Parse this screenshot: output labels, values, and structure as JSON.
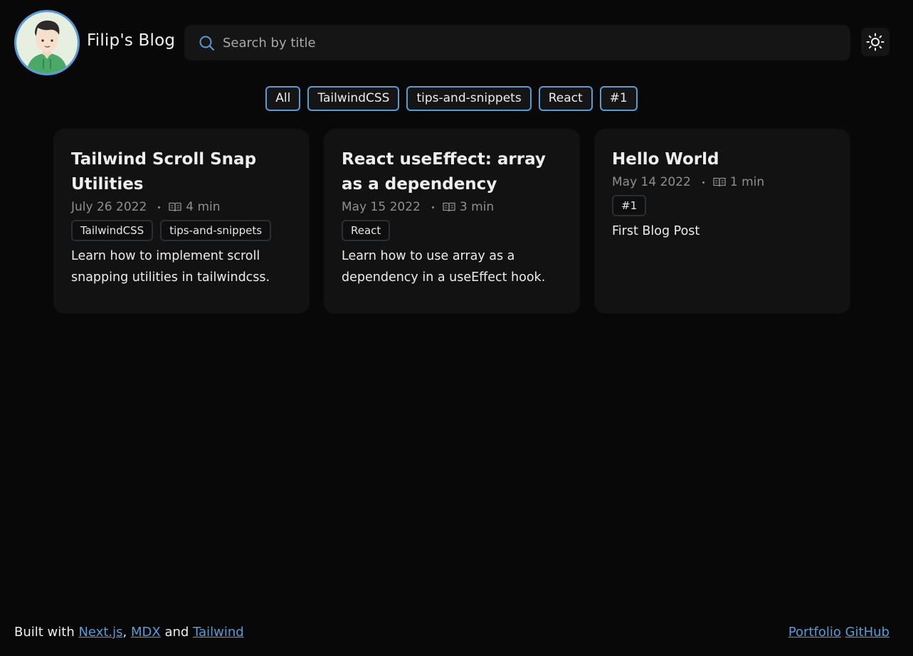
{
  "header": {
    "site_title": "Filip's Blog",
    "search_placeholder": "Search by title",
    "search_value": "",
    "theme_icon": "sun-icon"
  },
  "filters": [
    "All",
    "TailwindCSS",
    "tips-and-snippets",
    "React",
    "#1"
  ],
  "posts": [
    {
      "title": "Tailwind Scroll Snap Utilities",
      "date": "July 26 2022",
      "read_time": "4 min",
      "tags": [
        "TailwindCSS",
        "tips-and-snippets"
      ],
      "description": "Learn how to implement scroll snapping utilities in tailwindcss."
    },
    {
      "title": "React useEffect: array as a dependency",
      "date": "May 15 2022",
      "read_time": "3 min",
      "tags": [
        "React"
      ],
      "description": "Learn how to use array as a dependency in a useEffect hook."
    },
    {
      "title": "Hello World",
      "date": "May 14 2022",
      "read_time": "1 min",
      "tags": [
        "#1"
      ],
      "description": "First Blog Post"
    }
  ],
  "footer": {
    "built_with": "Built with",
    "link_nextjs": "Next.js",
    "comma": ",",
    "link_mdx": "MDX",
    "and": "and",
    "link_tailwind": "Tailwind",
    "link_portfolio": "Portfolio",
    "link_github": "GitHub"
  },
  "colors": {
    "background": "#080808",
    "card": "#121212",
    "accent": "#5b9bd5",
    "muted_text": "#8f8f8f"
  }
}
